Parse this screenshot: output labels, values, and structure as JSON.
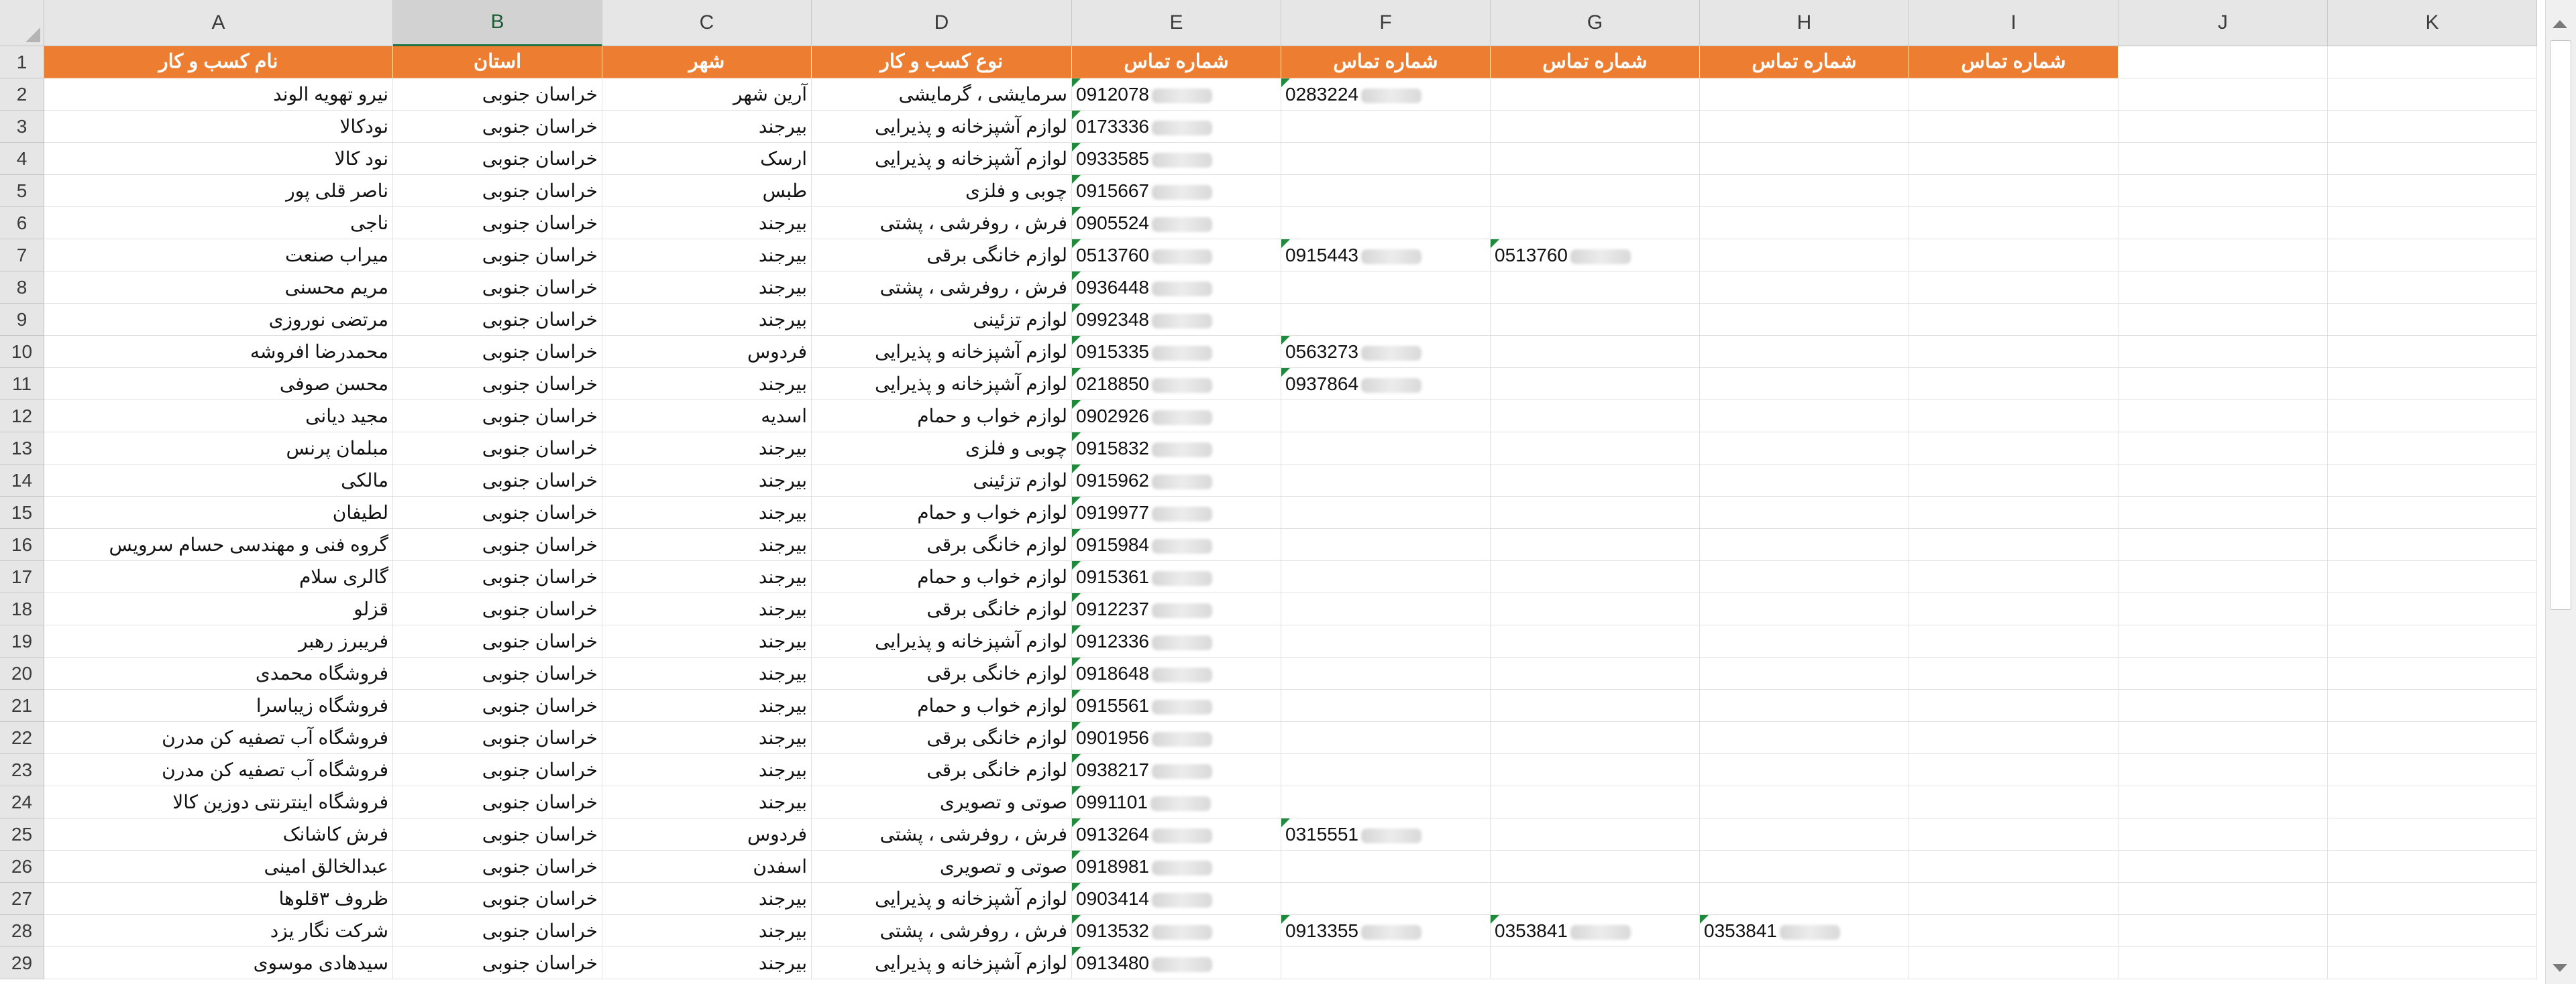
{
  "columns": [
    "A",
    "B",
    "C",
    "D",
    "E",
    "F",
    "G",
    "H",
    "I",
    "J",
    "K"
  ],
  "selected_column": "B",
  "header_row": {
    "A": "نام کسب و کار",
    "B": "استان",
    "C": "شهر",
    "D": "نوع کسب و کار",
    "E": "شماره تماس",
    "F": "شماره تماس",
    "G": "شماره تماس",
    "H": "شماره تماس",
    "I": "شماره تماس"
  },
  "rows": [
    {
      "n": "2",
      "A": "نیرو تهویه الوند",
      "B": "خراسان جنوبی",
      "C": "آرین شهر",
      "D": "سرمایشی ، گرمایشی",
      "E": "0912078",
      "F": "0283224",
      "G": "",
      "H": ""
    },
    {
      "n": "3",
      "A": "نودکالا",
      "B": "خراسان جنوبی",
      "C": "بیرجند",
      "D": "لوازم آشپزخانه و پذیرایی",
      "E": "0173336",
      "F": "",
      "G": "",
      "H": ""
    },
    {
      "n": "4",
      "A": "نود کالا",
      "B": "خراسان جنوبی",
      "C": "ارسک",
      "D": "لوازم آشپزخانه و پذیرایی",
      "E": "0933585",
      "F": "",
      "G": "",
      "H": ""
    },
    {
      "n": "5",
      "A": "ناصر قلی پور",
      "B": "خراسان جنوبی",
      "C": "طبس",
      "D": "چوبی و فلزی",
      "E": "0915667",
      "F": "",
      "G": "",
      "H": ""
    },
    {
      "n": "6",
      "A": "ناجی",
      "B": "خراسان جنوبی",
      "C": "بیرجند",
      "D": "فرش ، روفرشی ، پشتی",
      "E": "0905524",
      "F": "",
      "G": "",
      "H": ""
    },
    {
      "n": "7",
      "A": "میراب صنعت",
      "B": "خراسان جنوبی",
      "C": "بیرجند",
      "D": "لوازم خانگی برقی",
      "E": "0513760",
      "F": "0915443",
      "G": "0513760",
      "H": ""
    },
    {
      "n": "8",
      "A": "مریم محسنی",
      "B": "خراسان جنوبی",
      "C": "بیرجند",
      "D": "فرش ، روفرشی ، پشتی",
      "E": "0936448",
      "F": "",
      "G": "",
      "H": ""
    },
    {
      "n": "9",
      "A": "مرتضی نوروزی",
      "B": "خراسان جنوبی",
      "C": "بیرجند",
      "D": "لوازم تزئینی",
      "E": "0992348",
      "F": "",
      "G": "",
      "H": ""
    },
    {
      "n": "10",
      "A": "محمدرضا افروشه",
      "B": "خراسان جنوبی",
      "C": "فردوس",
      "D": "لوازم آشپزخانه و پذیرایی",
      "E": "0915335",
      "F": "0563273",
      "G": "",
      "H": ""
    },
    {
      "n": "11",
      "A": "محسن صوفی",
      "B": "خراسان جنوبی",
      "C": "بیرجند",
      "D": "لوازم آشپزخانه و پذیرایی",
      "E": "0218850",
      "F": "0937864",
      "G": "",
      "H": ""
    },
    {
      "n": "12",
      "A": "مجید دیانی",
      "B": "خراسان جنوبی",
      "C": "اسدیه",
      "D": "لوازم خواب و حمام",
      "E": "0902926",
      "F": "",
      "G": "",
      "H": ""
    },
    {
      "n": "13",
      "A": "مبلمان پرنس",
      "B": "خراسان جنوبی",
      "C": "بیرجند",
      "D": "چوبی و فلزی",
      "E": "0915832",
      "F": "",
      "G": "",
      "H": ""
    },
    {
      "n": "14",
      "A": "مالکی",
      "B": "خراسان جنوبی",
      "C": "بیرجند",
      "D": "لوازم تزئینی",
      "E": "0915962",
      "F": "",
      "G": "",
      "H": ""
    },
    {
      "n": "15",
      "A": "لطیفان",
      "B": "خراسان جنوبی",
      "C": "بیرجند",
      "D": "لوازم خواب و حمام",
      "E": "0919977",
      "F": "",
      "G": "",
      "H": ""
    },
    {
      "n": "16",
      "A": "گروه فنی و مهندسی حسام سرویس",
      "B": "خراسان جنوبی",
      "C": "بیرجند",
      "D": "لوازم خانگی برقی",
      "E": "0915984",
      "F": "",
      "G": "",
      "H": ""
    },
    {
      "n": "17",
      "A": "گالری سلام",
      "B": "خراسان جنوبی",
      "C": "بیرجند",
      "D": "لوازم خواب و حمام",
      "E": "0915361",
      "F": "",
      "G": "",
      "H": ""
    },
    {
      "n": "18",
      "A": "قزلو",
      "B": "خراسان جنوبی",
      "C": "بیرجند",
      "D": "لوازم خانگی برقی",
      "E": "0912237",
      "F": "",
      "G": "",
      "H": ""
    },
    {
      "n": "19",
      "A": "فریبرز رهبر",
      "B": "خراسان جنوبی",
      "C": "بیرجند",
      "D": "لوازم آشپزخانه و پذیرایی",
      "E": "0912336",
      "F": "",
      "G": "",
      "H": ""
    },
    {
      "n": "20",
      "A": "فروشگاه محمدی",
      "B": "خراسان جنوبی",
      "C": "بیرجند",
      "D": "لوازم خانگی برقی",
      "E": "0918648",
      "F": "",
      "G": "",
      "H": ""
    },
    {
      "n": "21",
      "A": "فروشگاه زیباسرا",
      "B": "خراسان جنوبی",
      "C": "بیرجند",
      "D": "لوازم خواب و حمام",
      "E": "0915561",
      "F": "",
      "G": "",
      "H": ""
    },
    {
      "n": "22",
      "A": "فروشگاه آب تصفیه کن مدرن",
      "B": "خراسان جنوبی",
      "C": "بیرجند",
      "D": "لوازم خانگی برقی",
      "E": "0901956",
      "F": "",
      "G": "",
      "H": ""
    },
    {
      "n": "23",
      "A": "فروشگاه آب تصفیه کن مدرن",
      "B": "خراسان جنوبی",
      "C": "بیرجند",
      "D": "لوازم خانگی برقی",
      "E": "0938217",
      "F": "",
      "G": "",
      "H": ""
    },
    {
      "n": "24",
      "A": "فروشگاه اینترنتی دوزین کالا",
      "B": "خراسان جنوبی",
      "C": "بیرجند",
      "D": "صوتی و تصویری",
      "E": "0991101",
      "F": "",
      "G": "",
      "H": ""
    },
    {
      "n": "25",
      "A": "فرش کاشانک",
      "B": "خراسان جنوبی",
      "C": "فردوس",
      "D": "فرش ، روفرشی ، پشتی",
      "E": "0913264",
      "F": "0315551",
      "G": "",
      "H": ""
    },
    {
      "n": "26",
      "A": "عبدالخالق امینی",
      "B": "خراسان جنوبی",
      "C": "اسفدن",
      "D": "صوتی و تصویری",
      "E": "0918981",
      "F": "",
      "G": "",
      "H": ""
    },
    {
      "n": "27",
      "A": "ظروف ۳قلوها",
      "B": "خراسان جنوبی",
      "C": "بیرجند",
      "D": "لوازم آشپزخانه و پذیرایی",
      "E": "0903414",
      "F": "",
      "G": "",
      "H": ""
    },
    {
      "n": "28",
      "A": "شرکت نگار یزد",
      "B": "خراسان جنوبی",
      "C": "بیرجند",
      "D": "فرش ، روفرشی ، پشتی",
      "E": "0913532",
      "F": "0913355",
      "G": "0353841",
      "H": "0353841"
    },
    {
      "n": "29",
      "A": "سیدهادی موسوی",
      "B": "خراسان جنوبی",
      "C": "بیرجند",
      "D": "لوازم آشپزخانه و پذیرایی",
      "E": "0913480",
      "F": "",
      "G": "",
      "H": ""
    }
  ]
}
